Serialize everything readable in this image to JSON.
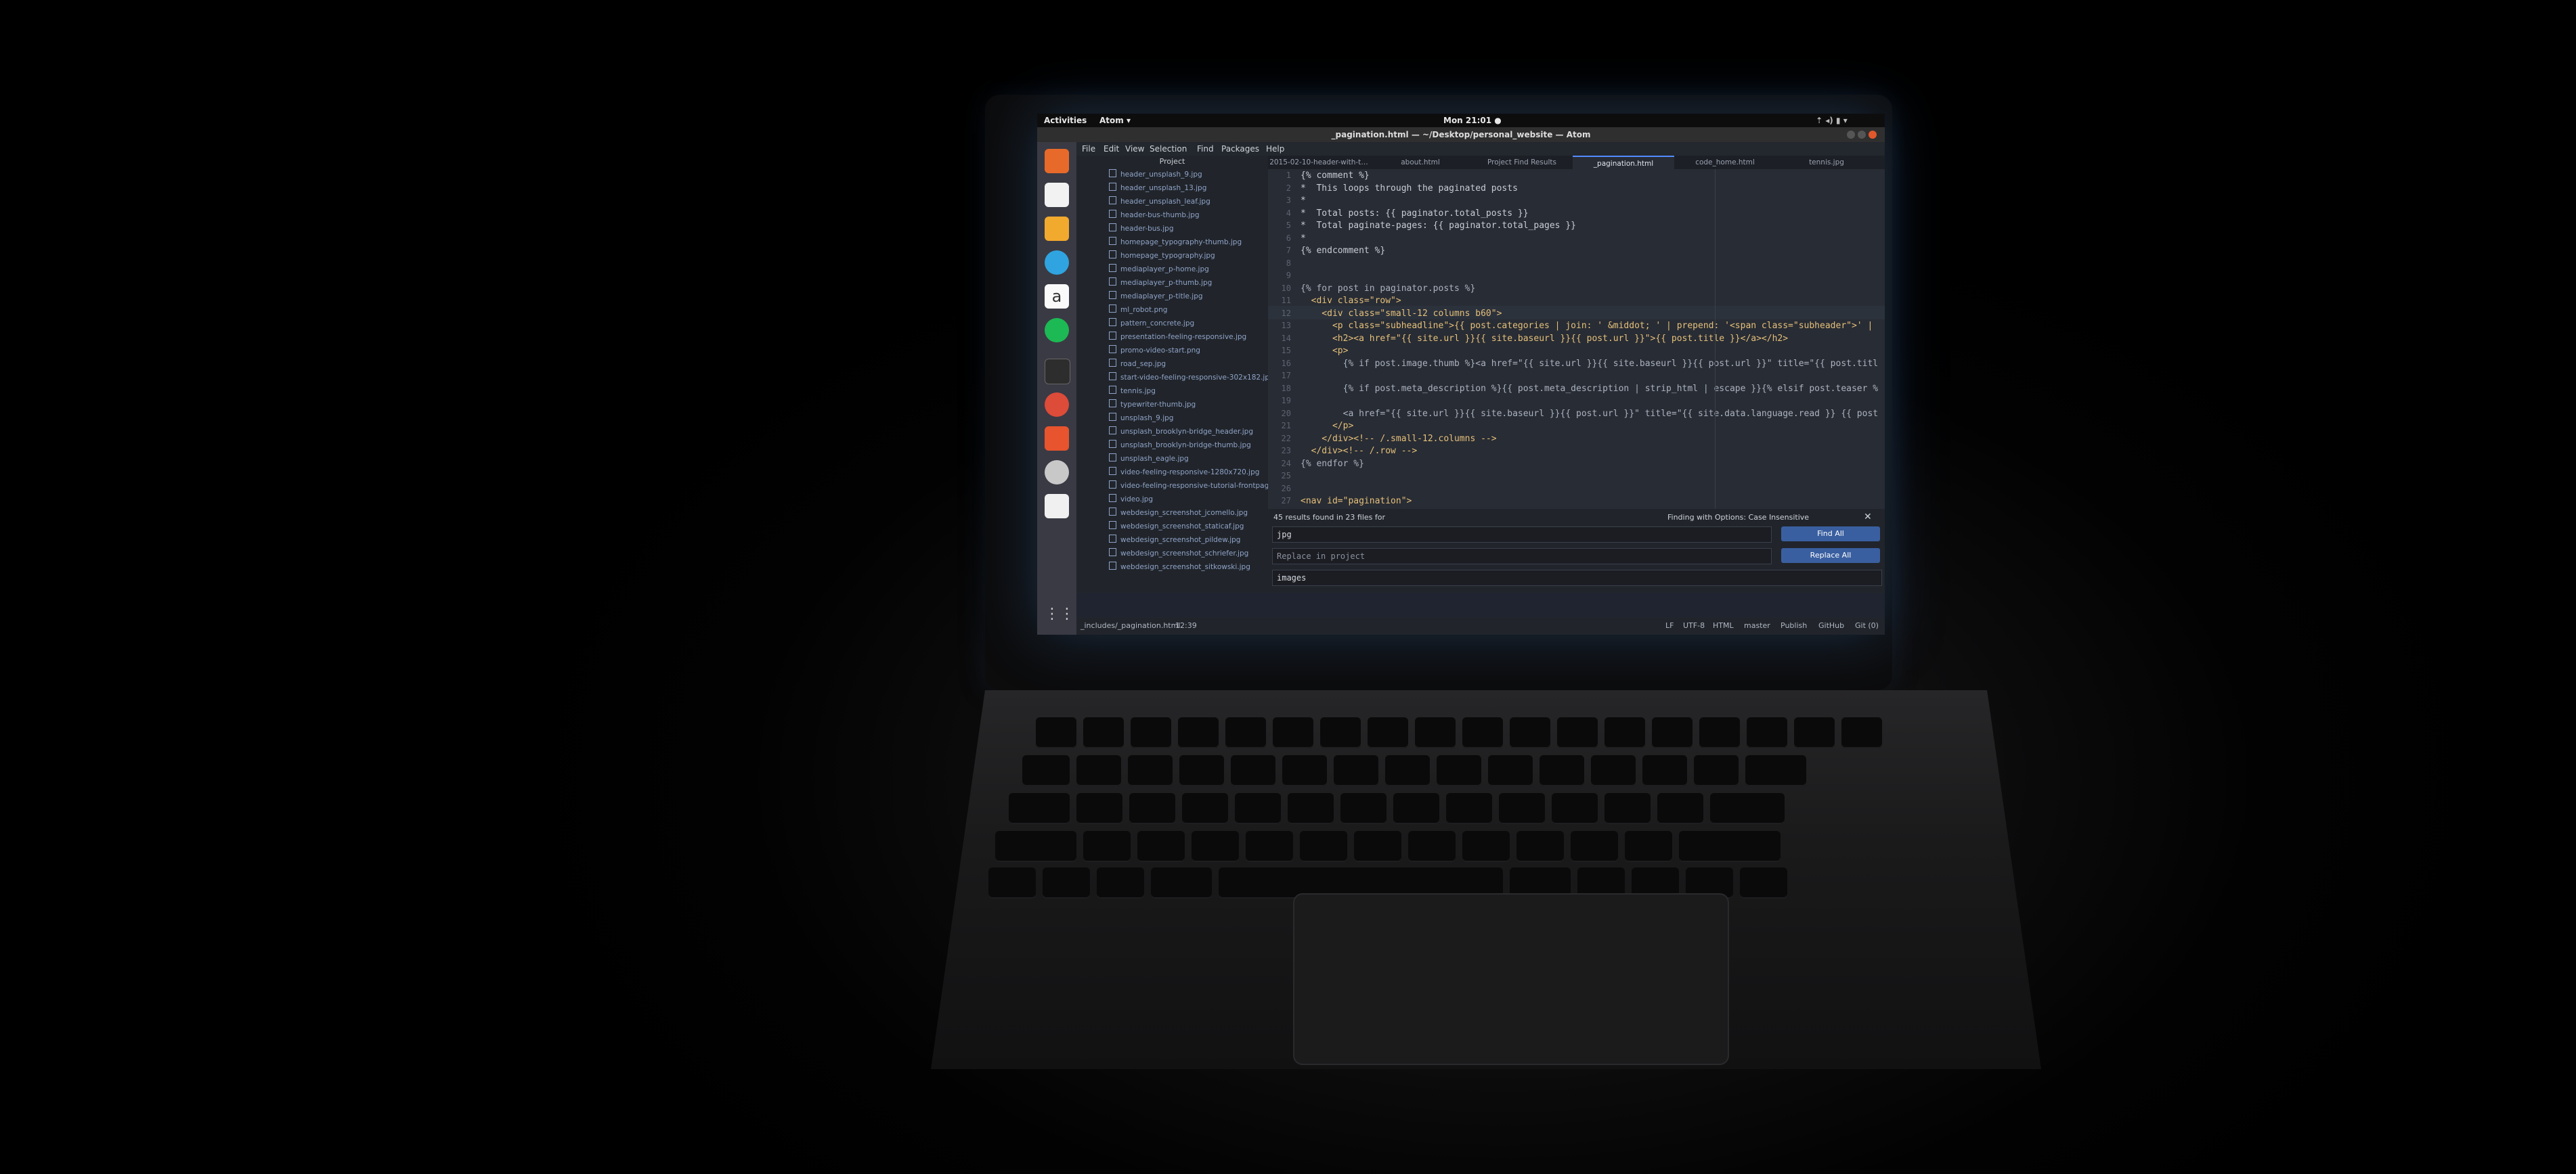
{
  "topbar": {
    "activities": "Activities",
    "app": "Atom ▾",
    "clock": "Mon 21:01 ●"
  },
  "window_title": "_pagination.html — ~/Desktop/personal_website — Atom",
  "menu": [
    "File",
    "Edit",
    "View",
    "Selection",
    "Find",
    "Packages",
    "Help"
  ],
  "tree": {
    "header": "Project",
    "files": [
      "header_unsplash_9.jpg",
      "header_unsplash_13.jpg",
      "header_unsplash_leaf.jpg",
      "header-bus-thumb.jpg",
      "header-bus.jpg",
      "homepage_typography-thumb.jpg",
      "homepage_typography.jpg",
      "mediaplayer_p-home.jpg",
      "mediaplayer_p-thumb.jpg",
      "mediaplayer_p-title.jpg",
      "ml_robot.png",
      "pattern_concrete.jpg",
      "presentation-feeling-responsive.jpg",
      "promo-video-start.png",
      "road_sep.jpg",
      "start-video-feeling-responsive-302x182.jpg",
      "tennis.jpg",
      "typewriter-thumb.jpg",
      "unsplash_9.jpg",
      "unsplash_brooklyn-bridge_header.jpg",
      "unsplash_brooklyn-bridge-thumb.jpg",
      "unsplash_eagle.jpg",
      "video-feeling-responsive-1280x720.jpg",
      "video-feeling-responsive-tutorial-frontpage.jpg",
      "video.jpg",
      "webdesign_screenshot_jcomello.jpg",
      "webdesign_screenshot_staticaf.jpg",
      "webdesign_screenshot_pildew.jpg",
      "webdesign_screenshot_schriefer.jpg",
      "webdesign_screenshot_sitkowski.jpg"
    ]
  },
  "tabs": [
    "2015-02-10-header-with-t…",
    "about.html",
    "Project Find Results",
    "_pagination.html",
    "code_home.html",
    "tennis.jpg"
  ],
  "editor": {
    "lines": [
      {
        "n": "1",
        "t": "{% comment %}"
      },
      {
        "n": "2",
        "t": "*  This loops through the paginated posts"
      },
      {
        "n": "3",
        "t": "*"
      },
      {
        "n": "4",
        "t": "*  Total posts: {{ paginator.total_posts }}"
      },
      {
        "n": "5",
        "t": "*  Total paginate-pages: {{ paginator.total_pages }}"
      },
      {
        "n": "6",
        "t": "*"
      },
      {
        "n": "7",
        "t": "{% endcomment %}"
      },
      {
        "n": "8",
        "t": ""
      },
      {
        "n": "9",
        "t": ""
      },
      {
        "n": "10",
        "t": "{% for post in paginator.posts %}"
      },
      {
        "n": "11",
        "t": "  <div class=\"row\">"
      },
      {
        "n": "12",
        "t": "    <div class=\"small-12 columns b60\">"
      },
      {
        "n": "13",
        "t": "      <p class=\"subheadline\">{{ post.categories | join: ' &middot; ' | prepend: '<span class=\"subheader\">' |"
      },
      {
        "n": "14",
        "t": "      <h2><a href=\"{{ site.url }}{{ site.baseurl }}{{ post.url }}\">{{ post.title }}</a></h2>"
      },
      {
        "n": "15",
        "t": "      <p>"
      },
      {
        "n": "16",
        "t": "        {% if post.image.thumb %}<a href=\"{{ site.url }}{{ site.baseurl }}{{ post.url }}\" title=\"{{ post.titl"
      },
      {
        "n": "17",
        "t": ""
      },
      {
        "n": "18",
        "t": "        {% if post.meta_description %}{{ post.meta_description | strip_html | escape }}{% elsif post.teaser %"
      },
      {
        "n": "19",
        "t": ""
      },
      {
        "n": "20",
        "t": "        <a href=\"{{ site.url }}{{ site.baseurl }}{{ post.url }}\" title=\"{{ site.data.language.read }} {{ post"
      },
      {
        "n": "21",
        "t": "      </p>"
      },
      {
        "n": "22",
        "t": "    </div><!-- /.small-12.columns -->"
      },
      {
        "n": "23",
        "t": "  </div><!-- /.row -->"
      },
      {
        "n": "24",
        "t": "{% endfor %}"
      },
      {
        "n": "25",
        "t": ""
      },
      {
        "n": "26",
        "t": ""
      },
      {
        "n": "27",
        "t": "<nav id=\"pagination\">"
      }
    ]
  },
  "find": {
    "summary": "45 results found in 23 files for",
    "options": "Finding with Options: Case Insensitive",
    "query": "jpg",
    "replace_placeholder": "Replace in project",
    "paths": "images",
    "find_all": "Find All",
    "replace_all": "Replace All"
  },
  "status": {
    "path": "_includes/_pagination.html",
    "pos": "12:39",
    "eol": "LF",
    "enc": "UTF-8",
    "grammar": "HTML",
    "branch": "master",
    "publish": "Publish",
    "github": "GitHub",
    "git": "Git (0)"
  },
  "colors": {
    "accent": "#528bff",
    "editor_bg": "#282c34",
    "tree_bg": "#21252b"
  }
}
